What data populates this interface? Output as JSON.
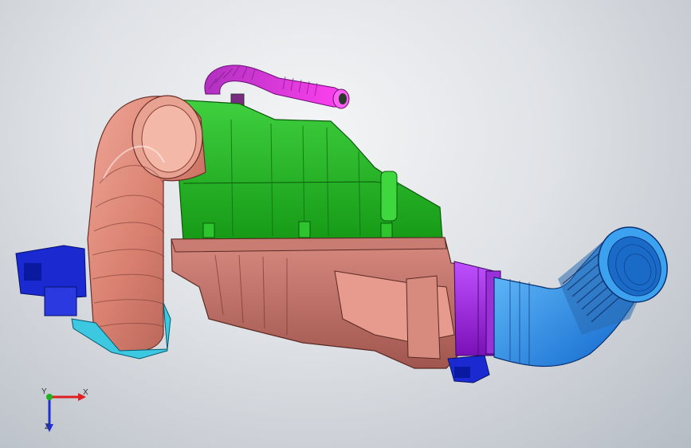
{
  "viewport": {
    "background_top": "#f4f5f6",
    "background_bottom": "#b6bcc4"
  },
  "model": {
    "parts": [
      {
        "name": "intake-elbow-duct",
        "color": "#d98070"
      },
      {
        "name": "air-filter-cover",
        "color": "#22b422"
      },
      {
        "name": "air-filter-housing",
        "color": "#c8776d"
      },
      {
        "name": "breather-hose",
        "color": "#e030d8"
      },
      {
        "name": "clamp-collar",
        "color": "#a020e0"
      },
      {
        "name": "bellows-outlet-hose",
        "color": "#1c8cf0"
      },
      {
        "name": "sensor-connector",
        "color": "#1a2ad0"
      },
      {
        "name": "mounting-bracket",
        "color": "#3cc8e0"
      }
    ]
  },
  "triad": {
    "x_label": "X",
    "y_label": "Y",
    "z_label": "Z",
    "x_color": "#e02020",
    "y_color": "#20b020",
    "z_color": "#2030d0"
  }
}
